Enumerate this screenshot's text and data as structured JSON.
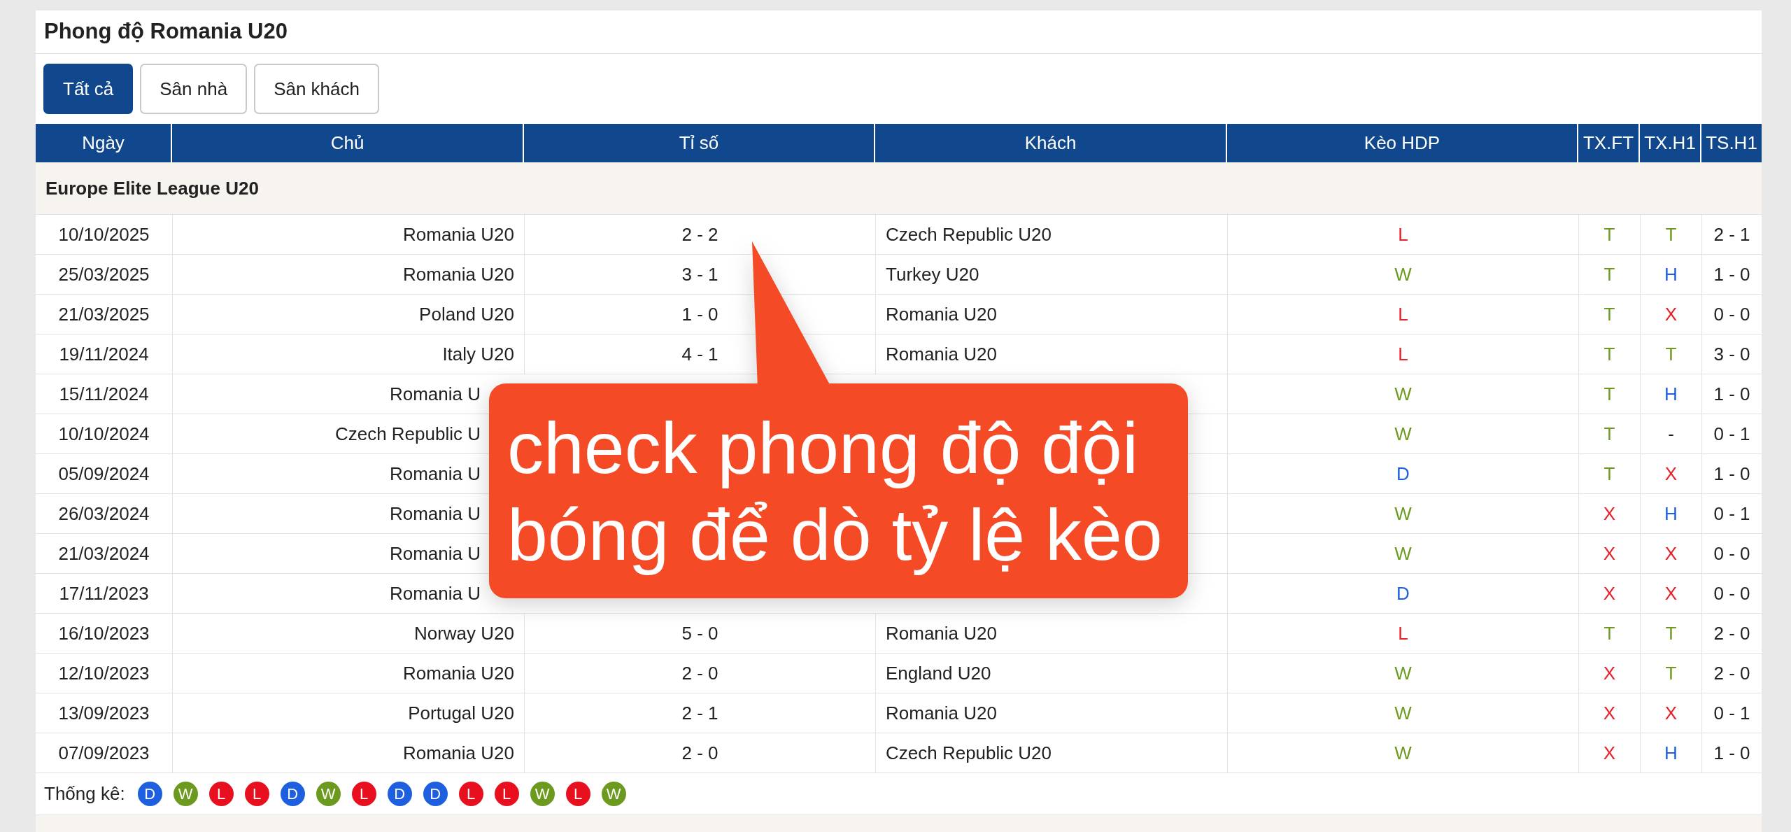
{
  "title": "Phong độ Romania U20",
  "filters": [
    {
      "label": "Tất cả",
      "selected": true
    },
    {
      "label": "Sân nhà",
      "selected": false
    },
    {
      "label": "Sân khách",
      "selected": false
    }
  ],
  "columns": [
    "Ngày",
    "Chủ",
    "Tỉ số",
    "Khách",
    "Kèo HDP",
    "TX.FT",
    "TX.H1",
    "TS.H1"
  ],
  "league": "Europe Elite League U20",
  "rows": [
    {
      "date": "10/10/2025",
      "home": "Romania U20",
      "score": "2 - 2",
      "away": "Czech Republic U20",
      "hdp": {
        "text": "L",
        "color": "#e8202a"
      },
      "tx_ft": {
        "text": "T",
        "color": "#6b9a1f"
      },
      "tx_h1": {
        "text": "T",
        "color": "#6b9a1f"
      },
      "ts_h1": "2 - 1"
    },
    {
      "date": "25/03/2025",
      "home": "Romania U20",
      "score": "3 - 1",
      "away": "Turkey U20",
      "hdp": {
        "text": "W",
        "color": "#6b9a1f"
      },
      "tx_ft": {
        "text": "T",
        "color": "#6b9a1f"
      },
      "tx_h1": {
        "text": "H",
        "color": "#1e5fe0"
      },
      "ts_h1": "1 - 0"
    },
    {
      "date": "21/03/2025",
      "home": "Poland U20",
      "score": "1 - 0",
      "away": "Romania U20",
      "hdp": {
        "text": "L",
        "color": "#e8202a"
      },
      "tx_ft": {
        "text": "T",
        "color": "#6b9a1f"
      },
      "tx_h1": {
        "text": "X",
        "color": "#e8202a"
      },
      "ts_h1": "0 - 0"
    },
    {
      "date": "19/11/2024",
      "home": "Italy U20",
      "score": "4 - 1",
      "away": "Romania U20",
      "hdp": {
        "text": "L",
        "color": "#e8202a"
      },
      "tx_ft": {
        "text": "T",
        "color": "#6b9a1f"
      },
      "tx_h1": {
        "text": "T",
        "color": "#6b9a1f"
      },
      "ts_h1": "3 - 0"
    },
    {
      "date": "15/11/2024",
      "home": "Romania U",
      "hdp": {
        "text": "W",
        "color": "#6b9a1f"
      },
      "tx_ft": {
        "text": "T",
        "color": "#6b9a1f"
      },
      "tx_h1": {
        "text": "H",
        "color": "#1e5fe0"
      },
      "ts_h1": "1 - 0"
    },
    {
      "date": "10/10/2024",
      "home": "Czech Republic U",
      "hdp": {
        "text": "W",
        "color": "#6b9a1f"
      },
      "tx_ft": {
        "text": "T",
        "color": "#6b9a1f"
      },
      "tx_h1": {
        "text": "-",
        "color": "#222222"
      },
      "ts_h1": "0 - 1"
    },
    {
      "date": "05/09/2024",
      "home": "Romania U",
      "hdp": {
        "text": "D",
        "color": "#1e5fe0"
      },
      "tx_ft": {
        "text": "T",
        "color": "#6b9a1f"
      },
      "tx_h1": {
        "text": "X",
        "color": "#e8202a"
      },
      "ts_h1": "1 - 0"
    },
    {
      "date": "26/03/2024",
      "home": "Romania U",
      "hdp": {
        "text": "W",
        "color": "#6b9a1f"
      },
      "tx_ft": {
        "text": "X",
        "color": "#e8202a"
      },
      "tx_h1": {
        "text": "H",
        "color": "#1e5fe0"
      },
      "ts_h1": "0 - 1"
    },
    {
      "date": "21/03/2024",
      "home": "Romania U",
      "hdp": {
        "text": "W",
        "color": "#6b9a1f"
      },
      "tx_ft": {
        "text": "X",
        "color": "#e8202a"
      },
      "tx_h1": {
        "text": "X",
        "color": "#e8202a"
      },
      "ts_h1": "0 - 0"
    },
    {
      "date": "17/11/2023",
      "home": "Romania U",
      "hdp": {
        "text": "D",
        "color": "#1e5fe0"
      },
      "tx_ft": {
        "text": "X",
        "color": "#e8202a"
      },
      "tx_h1": {
        "text": "X",
        "color": "#e8202a"
      },
      "ts_h1": "0 - 0"
    },
    {
      "date": "16/10/2023",
      "home": "Norway U20",
      "score": "5 - 0",
      "away": "Romania U20",
      "hdp": {
        "text": "L",
        "color": "#e8202a"
      },
      "tx_ft": {
        "text": "T",
        "color": "#6b9a1f"
      },
      "tx_h1": {
        "text": "T",
        "color": "#6b9a1f"
      },
      "ts_h1": "2 - 0"
    },
    {
      "date": "12/10/2023",
      "home": "Romania U20",
      "score": "2 - 0",
      "away": "England U20",
      "hdp": {
        "text": "W",
        "color": "#6b9a1f"
      },
      "tx_ft": {
        "text": "X",
        "color": "#e8202a"
      },
      "tx_h1": {
        "text": "T",
        "color": "#6b9a1f"
      },
      "ts_h1": "2 - 0"
    },
    {
      "date": "13/09/2023",
      "home": "Portugal U20",
      "score": "2 - 1",
      "away": "Romania U20",
      "hdp": {
        "text": "W",
        "color": "#6b9a1f"
      },
      "tx_ft": {
        "text": "X",
        "color": "#e8202a"
      },
      "tx_h1": {
        "text": "X",
        "color": "#e8202a"
      },
      "ts_h1": "0 - 1"
    },
    {
      "date": "07/09/2023",
      "home": "Romania U20",
      "score": "2 - 0",
      "away": "Czech Republic U20",
      "hdp": {
        "text": "W",
        "color": "#6b9a1f"
      },
      "tx_ft": {
        "text": "X",
        "color": "#e8202a"
      },
      "tx_h1": {
        "text": "H",
        "color": "#1e5fe0"
      },
      "ts_h1": "1 - 0"
    }
  ],
  "stats": {
    "label": "Thống kê:",
    "results": [
      {
        "text": "D",
        "color": "#1e5fe0"
      },
      {
        "text": "W",
        "color": "#6b9a1f"
      },
      {
        "text": "L",
        "color": "#e8101e"
      },
      {
        "text": "L",
        "color": "#e8101e"
      },
      {
        "text": "D",
        "color": "#1e5fe0"
      },
      {
        "text": "W",
        "color": "#6b9a1f"
      },
      {
        "text": "L",
        "color": "#e8101e"
      },
      {
        "text": "D",
        "color": "#1e5fe0"
      },
      {
        "text": "D",
        "color": "#1e5fe0"
      },
      {
        "text": "L",
        "color": "#e8101e"
      },
      {
        "text": "L",
        "color": "#e8101e"
      },
      {
        "text": "W",
        "color": "#6b9a1f"
      },
      {
        "text": "L",
        "color": "#e8101e"
      },
      {
        "text": "W",
        "color": "#6b9a1f"
      }
    ]
  },
  "callout": {
    "lines": [
      "check phong độ đội",
      "bóng để dò tỷ lệ kèo"
    ]
  }
}
